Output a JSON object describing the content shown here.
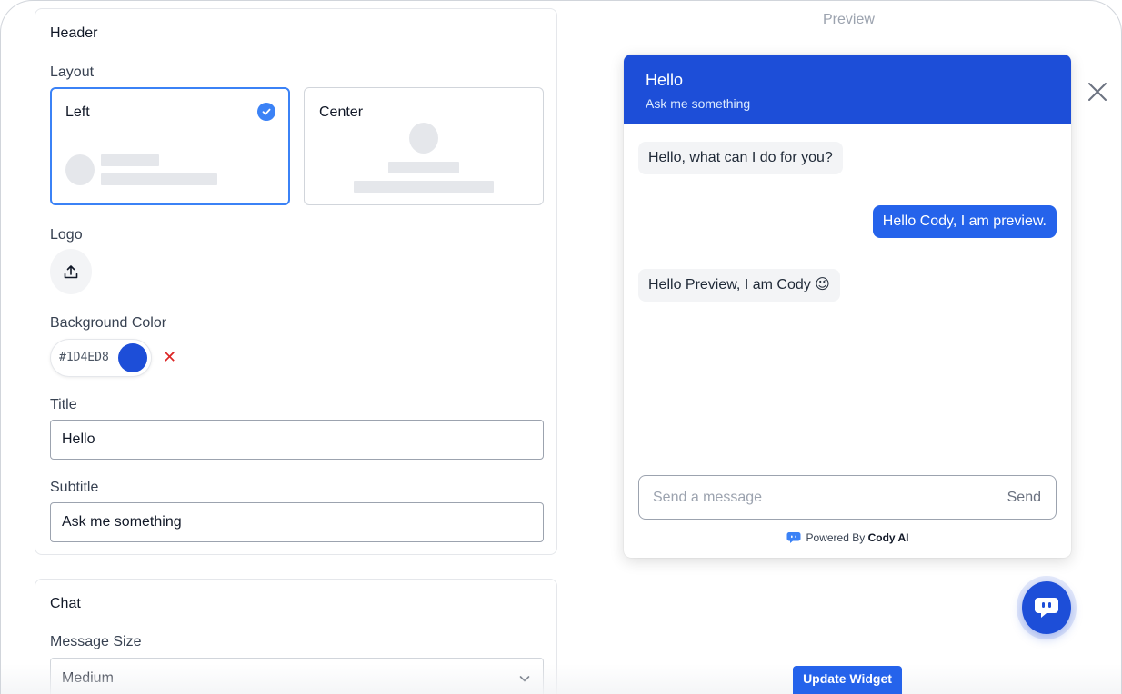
{
  "colors": {
    "accent": "#1D4ED8",
    "selected_border": "#3B82F6",
    "user_bubble": "#2563EB",
    "clear": "#DC2626"
  },
  "header_section": {
    "title": "Header",
    "layout_label": "Layout",
    "layout_options": [
      {
        "label": "Left",
        "selected": true
      },
      {
        "label": "Center",
        "selected": false
      }
    ],
    "logo_label": "Logo",
    "logo_icon": "upload-icon",
    "background_color_label": "Background Color",
    "background_color_value": "#1D4ED8",
    "title_label": "Title",
    "title_value": "Hello",
    "subtitle_label": "Subtitle",
    "subtitle_value": "Ask me something"
  },
  "chat_section": {
    "title": "Chat",
    "message_size_label": "Message Size",
    "message_size_value": "Medium"
  },
  "preview": {
    "label": "Preview",
    "widget": {
      "title": "Hello",
      "subtitle": "Ask me something",
      "messages": [
        {
          "role": "bot",
          "text": "Hello, what can I do for you?"
        },
        {
          "role": "user",
          "text": "Hello Cody, I am preview."
        },
        {
          "role": "bot",
          "text": "Hello Preview, I am Cody 😉"
        }
      ],
      "input_placeholder": "Send a message",
      "send_label": "Send",
      "powered_prefix": "Powered By",
      "powered_brand": "Cody AI"
    }
  },
  "update_button_label": "Update Widget"
}
